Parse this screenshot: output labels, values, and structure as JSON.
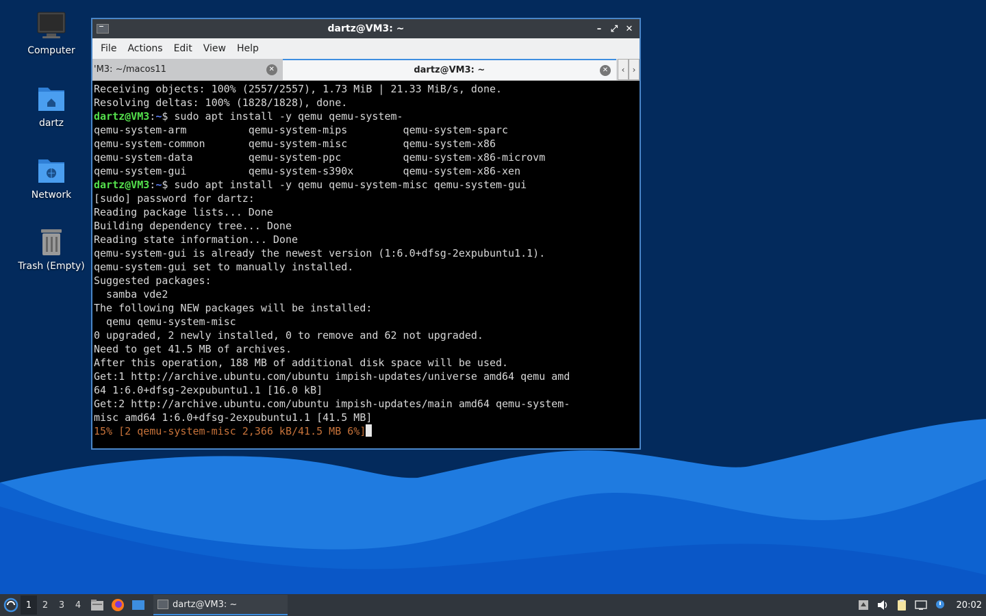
{
  "desktop": {
    "icons": [
      {
        "label": "Computer"
      },
      {
        "label": "dartz"
      },
      {
        "label": "Network"
      },
      {
        "label": "Trash (Empty)"
      }
    ]
  },
  "window": {
    "title": "dartz@VM3: ~",
    "controls": {
      "minimize": "–",
      "maximize": "⤢",
      "close": "✕"
    }
  },
  "menubar": {
    "items": [
      "File",
      "Actions",
      "Edit",
      "View",
      "Help"
    ]
  },
  "tabs": [
    {
      "label": "'M3: ~/macos11",
      "active": false
    },
    {
      "label": "dartz@VM3: ~",
      "active": true
    }
  ],
  "tab_scroll": {
    "left": "‹",
    "right": "›"
  },
  "terminal": {
    "prompt_user": "dartz@VM3",
    "prompt_sep": ":",
    "prompt_path": "~",
    "prompt_end": "$ ",
    "lines": [
      {
        "type": "text",
        "text": "Receiving objects: 100% (2557/2557), 1.73 MiB | 21.33 MiB/s, done."
      },
      {
        "type": "text",
        "text": "Resolving deltas: 100% (1828/1828), done."
      },
      {
        "type": "prompt",
        "text": "sudo apt install -y qemu qemu-system-"
      },
      {
        "type": "text",
        "text": "qemu-system-arm          qemu-system-mips         qemu-system-sparc"
      },
      {
        "type": "text",
        "text": "qemu-system-common       qemu-system-misc         qemu-system-x86"
      },
      {
        "type": "text",
        "text": "qemu-system-data         qemu-system-ppc          qemu-system-x86-microvm"
      },
      {
        "type": "text",
        "text": "qemu-system-gui          qemu-system-s390x        qemu-system-x86-xen"
      },
      {
        "type": "prompt",
        "text": "sudo apt install -y qemu qemu-system-misc qemu-system-gui"
      },
      {
        "type": "text",
        "text": "[sudo] password for dartz:"
      },
      {
        "type": "text",
        "text": "Reading package lists... Done"
      },
      {
        "type": "text",
        "text": "Building dependency tree... Done"
      },
      {
        "type": "text",
        "text": "Reading state information... Done"
      },
      {
        "type": "text",
        "text": "qemu-system-gui is already the newest version (1:6.0+dfsg-2expubuntu1.1)."
      },
      {
        "type": "text",
        "text": "qemu-system-gui set to manually installed."
      },
      {
        "type": "text",
        "text": "Suggested packages:"
      },
      {
        "type": "text",
        "text": "  samba vde2"
      },
      {
        "type": "text",
        "text": "The following NEW packages will be installed:"
      },
      {
        "type": "text",
        "text": "  qemu qemu-system-misc"
      },
      {
        "type": "text",
        "text": "0 upgraded, 2 newly installed, 0 to remove and 62 not upgraded."
      },
      {
        "type": "text",
        "text": "Need to get 41.5 MB of archives."
      },
      {
        "type": "text",
        "text": "After this operation, 188 MB of additional disk space will be used."
      },
      {
        "type": "text",
        "text": "Get:1 http://archive.ubuntu.com/ubuntu impish-updates/universe amd64 qemu amd"
      },
      {
        "type": "text",
        "text": "64 1:6.0+dfsg-2expubuntu1.1 [16.0 kB]"
      },
      {
        "type": "text",
        "text": "Get:2 http://archive.ubuntu.com/ubuntu impish-updates/main amd64 qemu-system-"
      },
      {
        "type": "text",
        "text": "misc amd64 1:6.0+dfsg-2expubuntu1.1 [41.5 MB]"
      },
      {
        "type": "progress",
        "text": "15% [2 qemu-system-misc 2,366 kB/41.5 MB 6%]"
      }
    ]
  },
  "taskbar": {
    "workspaces": [
      "1",
      "2",
      "3",
      "4"
    ],
    "current_workspace": "1",
    "task_label": "dartz@VM3: ~",
    "clock": "20:02"
  },
  "colors": {
    "prompt_user": "#54e04c",
    "prompt_path": "#5a7cf2",
    "progress": "#c8733a",
    "accent": "#3d8ee0"
  }
}
